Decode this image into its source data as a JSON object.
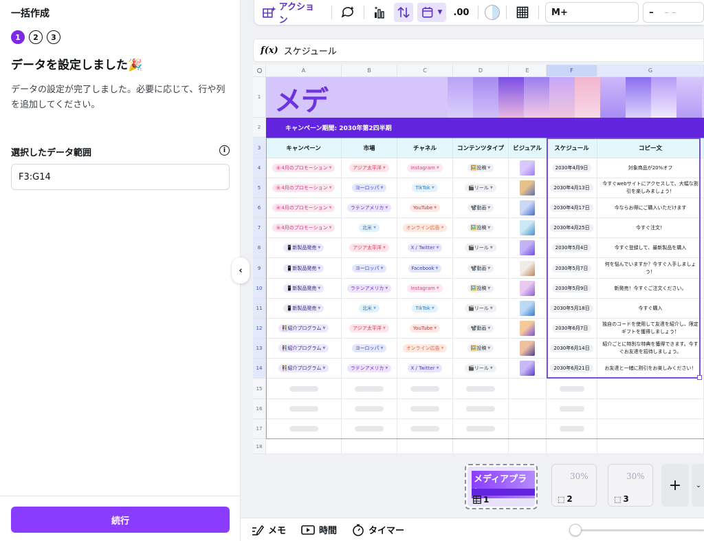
{
  "left_panel": {
    "title": "一括作成",
    "steps": [
      "1",
      "2",
      "3"
    ],
    "heading": "データを設定しました🎉",
    "description": "データの設定が完了しました。必要に応じて、行や列を追加してください。",
    "range_label": "選択したデータ範囲",
    "range_value": "F3:G14",
    "continue_label": "続行"
  },
  "toolbar": {
    "action_label": "アクション",
    "decimal_label": ".00",
    "font_size_value": "M+",
    "number_value": "–",
    "number_placeholder": "– –"
  },
  "formula_bar": {
    "fx_label": "f(x)",
    "content": "スケジュール"
  },
  "sheet": {
    "column_letters": [
      "A",
      "B",
      "C",
      "D",
      "E",
      "F",
      "G"
    ],
    "row_numbers": [
      "1",
      "2",
      "3",
      "4",
      "5",
      "6",
      "7",
      "8",
      "9",
      "10",
      "11",
      "12",
      "13",
      "14",
      "15",
      "16",
      "17",
      "18"
    ],
    "banner_text": "メデ",
    "campaign_period": "キャンペーン期間: 2030年第2四半期",
    "headers": [
      "キャンペーン",
      "市場",
      "チャネル",
      "コンテンツタイプ",
      "ビジュアル",
      "スケジュール",
      "コピー文"
    ],
    "rows": [
      {
        "campaign": "🌸4月のプロモーション",
        "market": "アジア太平洋",
        "channel": "Instagram",
        "ctype": "🖼️投稿",
        "schedule": "2030年4月9日",
        "copy": "対象商品が20%オフ"
      },
      {
        "campaign": "🌸4月のプロモーション",
        "market": "ヨーロッパ",
        "channel": "TikTok",
        "ctype": "🎬リール",
        "schedule": "2030年4月13日",
        "copy": "今すぐwebサイトにアクセスして、大幅な割引を楽しみましょう！"
      },
      {
        "campaign": "🌸4月のプロモーション",
        "market": "ラテンアメリカ",
        "channel": "YouTube",
        "ctype": "📽️動画",
        "schedule": "2030年4月17日",
        "copy": "今ならお得にご購入いただけます"
      },
      {
        "campaign": "🌸4月のプロモーション",
        "market": "北米",
        "channel": "オンライン広告",
        "ctype": "🖼️投稿",
        "schedule": "2030年4月25日",
        "copy": "今すぐ注文！"
      },
      {
        "campaign": "📱新製品発売",
        "market": "アジア太平洋",
        "channel": "X / Twitter",
        "ctype": "🎬リール",
        "schedule": "2030年5月4日",
        "copy": "今すぐ登録して、最新製品を購入"
      },
      {
        "campaign": "📱新製品発売",
        "market": "ヨーロッパ",
        "channel": "Facebook",
        "ctype": "📽️動画",
        "schedule": "2030年5月7日",
        "copy": "何を悩んでいますか？今すぐ入手しましょう！"
      },
      {
        "campaign": "📱新製品発売",
        "market": "ラテンアメリカ",
        "channel": "Instagram",
        "ctype": "🖼️投稿",
        "schedule": "2030年5月9日",
        "copy": "新発売！今すぐご注文ください。"
      },
      {
        "campaign": "📱新製品発売",
        "market": "北米",
        "channel": "TikTok",
        "ctype": "🎬リール",
        "schedule": "2030年5月18日",
        "copy": "今すぐ購入"
      },
      {
        "campaign": "👫紹介プログラム",
        "market": "アジア太平洋",
        "channel": "YouTube",
        "ctype": "📽️動画",
        "schedule": "2030年6月7日",
        "copy": "独自のコードを使用して友達を紹介し、限定ギフトを獲得しましょう！"
      },
      {
        "campaign": "👫紹介プログラム",
        "market": "ヨーロッパ",
        "channel": "オンライン広告",
        "ctype": "🖼️投稿",
        "schedule": "2030年6月14日",
        "copy": "紹介ごとに特別な特典を獲得できます。今すぐお友達を招待しましょう。"
      },
      {
        "campaign": "👫紹介プログラム",
        "market": "ラテンアメリカ",
        "channel": "X / Twitter",
        "ctype": "🎬リール",
        "schedule": "2030年6月21日",
        "copy": "お友達と一緒に割引をお楽しみください！"
      }
    ]
  },
  "pages": {
    "page1_title": "メディアプラン",
    "page1_num": "1",
    "page2_num": "2",
    "page3_num": "3",
    "sale_text": "30%"
  },
  "footer": {
    "notes_label": "メモ",
    "time_label": "時間",
    "timer_label": "タイマー"
  },
  "colors": {
    "accent": "#8b3dff",
    "banner_purple": "#6324e0",
    "header_bg": "#e3f7fc",
    "selection": "#7c4ae8"
  }
}
